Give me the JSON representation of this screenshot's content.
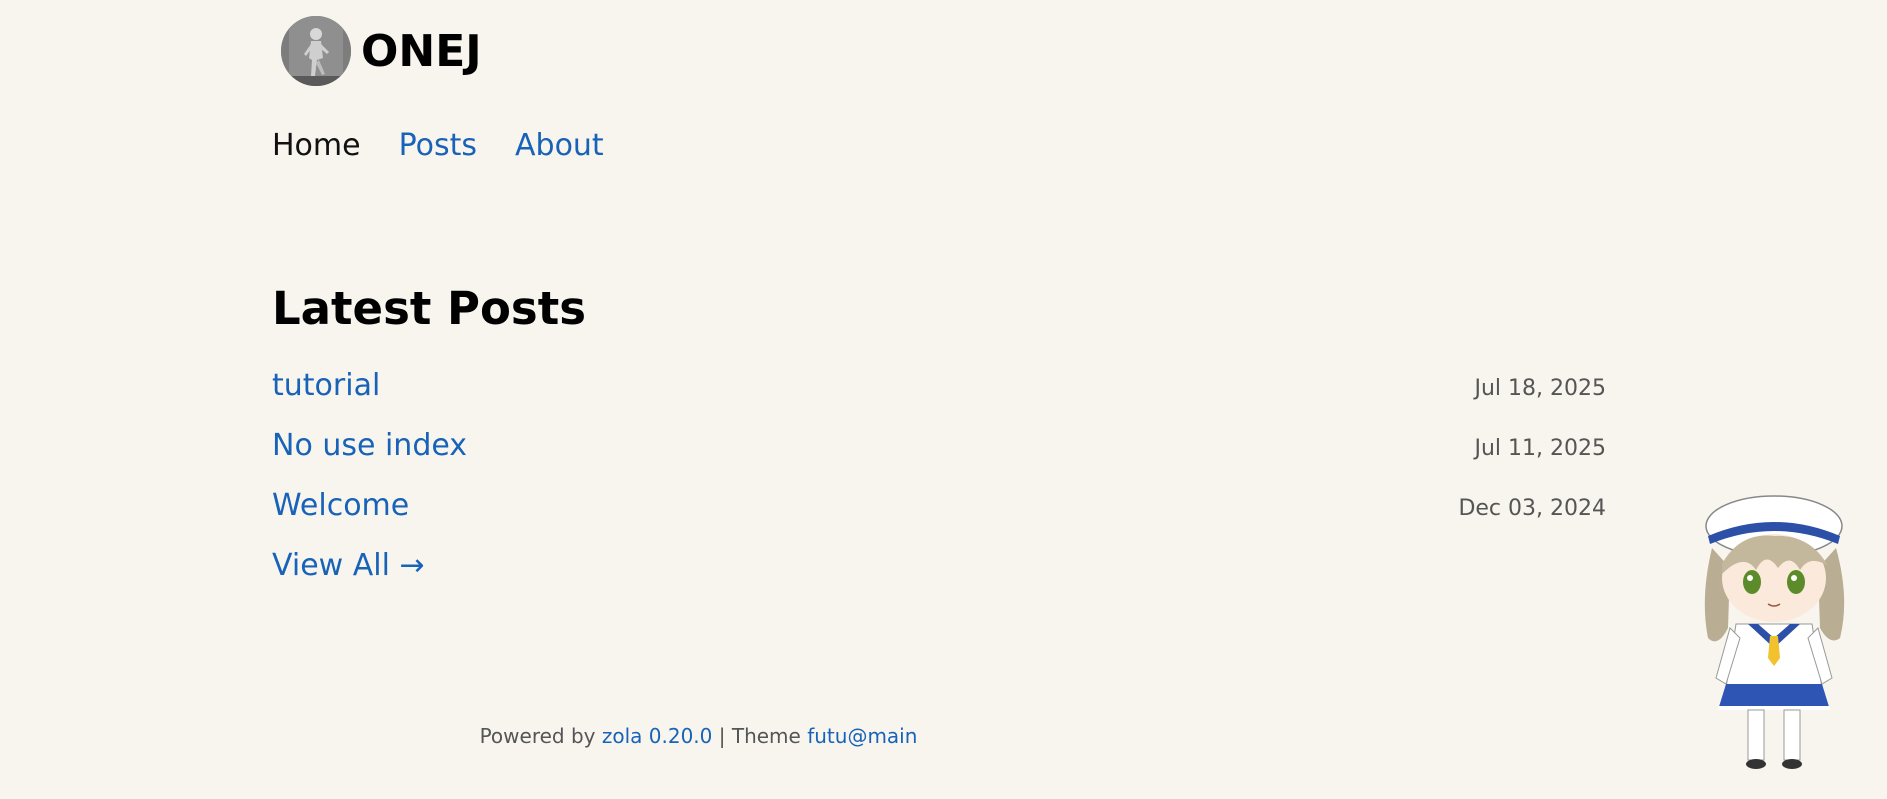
{
  "site": {
    "title": "ONEJ"
  },
  "nav": {
    "items": [
      {
        "label": "Home",
        "active": true
      },
      {
        "label": "Posts",
        "active": false
      },
      {
        "label": "About",
        "active": false
      }
    ]
  },
  "main": {
    "heading": "Latest Posts",
    "posts": [
      {
        "title": "tutorial",
        "date": "Jul 18, 2025"
      },
      {
        "title": "No use index",
        "date": "Jul 11, 2025"
      },
      {
        "title": "Welcome",
        "date": "Dec 03, 2024"
      }
    ],
    "view_all": "View All →"
  },
  "footer": {
    "powered_prefix": "Powered by",
    "zola_link": "zola 0.20.0",
    "separator": "| Theme",
    "theme_link": "futu@main"
  },
  "colors": {
    "background": "#f8f5ef",
    "link": "#1863b8",
    "text": "#111111",
    "muted": "#555555"
  },
  "icons": {
    "avatar": "runner-photo-avatar",
    "mascot": "sailor-girl-mascot"
  }
}
